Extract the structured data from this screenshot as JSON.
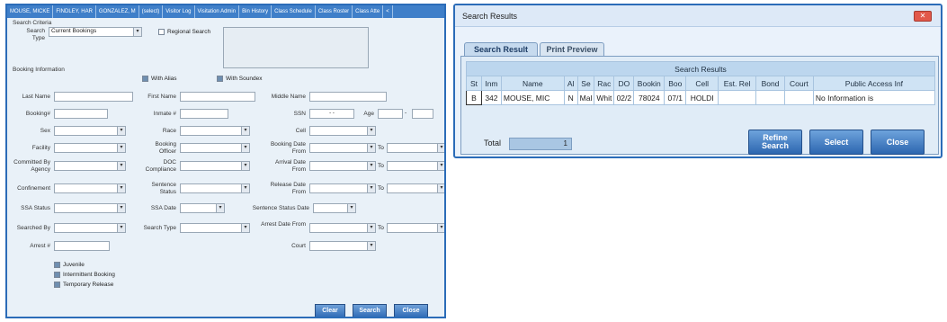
{
  "left": {
    "tabs": [
      "MOUSE, MICKE",
      "FINDLEY, HAR",
      "GONZALEZ, M",
      "(select)",
      "Visitor Log",
      "Visitation Admin",
      "Bin History",
      "Class Schedule",
      "Class Roster",
      "Class Atte",
      "<"
    ],
    "search_criteria": "Search Criteria",
    "search_type_label": "Search Type",
    "search_type_value": "Current Bookings",
    "regional_search": "Regional Search",
    "booking_information": "Booking Information",
    "with_alias": "With Alias",
    "with_soundex": "With Soundex",
    "last_name": "Last Name",
    "first_name": "First Name",
    "middle_name": "Middle Name",
    "booking_num": "Booking#",
    "inmate_num": "Inmate #",
    "ssn": "SSN",
    "ssn_value": "-   -",
    "age": "Age",
    "age_sep": "-",
    "sex": "Sex",
    "race": "Race",
    "cell": "Cell",
    "facility": "Facility",
    "booking_officer": "Booking Officer",
    "booking_date_from": "Booking Date From",
    "to": "To",
    "committed_by_agency": "Committed By Agency",
    "doc_compliance": "DOC Compliance",
    "arrival_date_from": "Arrival Date From",
    "confinement": "Confinement",
    "sentence_status": "Sentence Status",
    "release_date_from": "Release Date From",
    "ssa_status": "SSA Status",
    "ssa_date": "SSA Date",
    "sentence_status_date": "Sentence Status Date",
    "searched_by": "Searched By",
    "search_type2": "Search Type",
    "arrest_date_from": "Arrest Date From",
    "arrest_num": "Arrest #",
    "court": "Court",
    "juvenile": "Juvenile",
    "intermittent_booking": "Intermittent Booking",
    "temporary_release": "Temporary Release",
    "clear": "Clear",
    "search": "Search",
    "close": "Close"
  },
  "right": {
    "title": "Search Results",
    "close_x": "✕",
    "tab_search_result": "Search Result",
    "tab_print_preview": "Print Preview",
    "grid_caption": "Search Results",
    "columns": [
      "St",
      "Inm",
      "Name",
      "Al",
      "Se",
      "Rac",
      "DO",
      "Bookin",
      "Boo",
      "Cell",
      "Est. Rel",
      "Bond",
      "Court",
      "Public Access Inf"
    ],
    "row": [
      "B",
      "342",
      "MOUSE, MIC",
      "N",
      "Mal",
      "Whit",
      "02/2",
      "78024",
      "07/1",
      "HOLDI",
      "",
      "",
      "",
      "No Information is"
    ],
    "total_label": "Total",
    "total_value": "1",
    "refine_search": "Refine Search",
    "select": "Select",
    "close": "Close"
  }
}
